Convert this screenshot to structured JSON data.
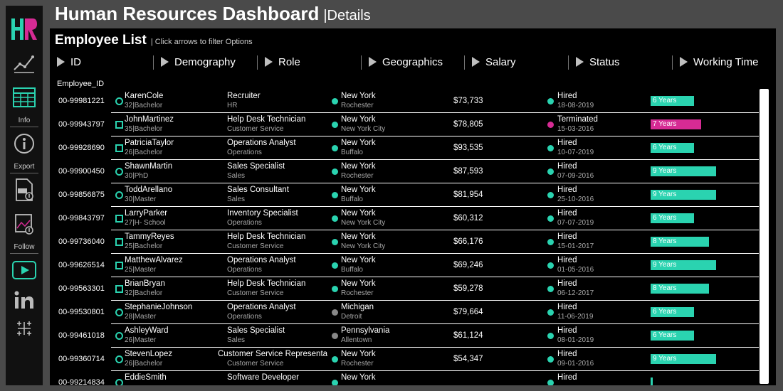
{
  "header": {
    "title": "Human Resources Dashboard",
    "subtitle": "|Details"
  },
  "sidebar": {
    "logo": "HR",
    "info_label": "Info",
    "export_label": "Export",
    "follow_label": "Follow",
    "colors": {
      "accent": "#2ad3b0",
      "accent2": "#d62b94"
    }
  },
  "panel": {
    "title": "Employee List",
    "hint": "| Click arrows to filter Options"
  },
  "columns": [
    "ID",
    "Demography",
    "Role",
    "Geographics",
    "Salary",
    "Status",
    "Working Time"
  ],
  "employee_id_header": "Employee_ID",
  "colors": {
    "teal": "#2ad3b0",
    "magenta": "#d62b94",
    "gray": "#888888"
  },
  "rows": [
    {
      "id": "00-99981221",
      "mark": "circle",
      "name": "KarenCole",
      "demo": "32|Bachelor",
      "role": "Recruiter",
      "dept": "HR",
      "geo_dot": "teal",
      "state": "New York",
      "city": "Rochester",
      "salary": "$73,733",
      "status": "Hired",
      "status_dot": "teal",
      "date": "18-08-2019",
      "years": "6 Years",
      "years_num": 6,
      "bar": "teal"
    },
    {
      "id": "00-99943797",
      "mark": "square",
      "name": "JohnMartinez",
      "demo": "35|Bachelor",
      "role": "Help Desk Technician",
      "dept": "Customer Service",
      "geo_dot": "teal",
      "state": "New York",
      "city": "New York City",
      "salary": "$78,805",
      "status": "Terminated",
      "status_dot": "magenta",
      "date": "15-03-2016",
      "years": "7 Years",
      "years_num": 7,
      "bar": "magenta"
    },
    {
      "id": "00-99928690",
      "mark": "square",
      "name": "PatriciaTaylor",
      "demo": "26|Bachelor",
      "role": "Operations Analyst",
      "dept": "Operations",
      "geo_dot": "teal",
      "state": "New York",
      "city": "Buffalo",
      "salary": "$93,535",
      "status": "Hired",
      "status_dot": "teal",
      "date": "10-07-2019",
      "years": "6 Years",
      "years_num": 6,
      "bar": "teal"
    },
    {
      "id": "00-99900450",
      "mark": "circle",
      "name": "ShawnMartin",
      "demo": "30|PhD",
      "role": "Sales Specialist",
      "dept": "Sales",
      "geo_dot": "teal",
      "state": "New York",
      "city": "Rochester",
      "salary": "$87,593",
      "status": "Hired",
      "status_dot": "teal",
      "date": "07-09-2016",
      "years": "9 Years",
      "years_num": 9,
      "bar": "teal"
    },
    {
      "id": "00-99856875",
      "mark": "circle",
      "name": "ToddArellano",
      "demo": "30|Master",
      "role": "Sales Consultant",
      "dept": "Sales",
      "geo_dot": "teal",
      "state": "New York",
      "city": "Buffalo",
      "salary": "$81,954",
      "status": "Hired",
      "status_dot": "teal",
      "date": "25-10-2016",
      "years": "9 Years",
      "years_num": 9,
      "bar": "teal"
    },
    {
      "id": "00-99843797",
      "mark": "square",
      "name": "LarryParker",
      "demo": "27|H- School",
      "role": "Inventory Specialist",
      "dept": "Operations",
      "geo_dot": "teal",
      "state": "New York",
      "city": "New York City",
      "salary": "$60,312",
      "status": "Hired",
      "status_dot": "teal",
      "date": "07-07-2019",
      "years": "6 Years",
      "years_num": 6,
      "bar": "teal"
    },
    {
      "id": "00-99736040",
      "mark": "square",
      "name": "TammyReyes",
      "demo": "25|Bachelor",
      "role": "Help Desk Technician",
      "dept": "Customer Service",
      "geo_dot": "teal",
      "state": "New York",
      "city": "New York City",
      "salary": "$66,176",
      "status": "Hired",
      "status_dot": "teal",
      "date": "15-01-2017",
      "years": "8 Years",
      "years_num": 8,
      "bar": "teal"
    },
    {
      "id": "00-99626514",
      "mark": "square",
      "name": "MatthewAlvarez",
      "demo": "25|Master",
      "role": "Operations Analyst",
      "dept": "Operations",
      "geo_dot": "teal",
      "state": "New York",
      "city": "Buffalo",
      "salary": "$69,246",
      "status": "Hired",
      "status_dot": "teal",
      "date": "01-05-2016",
      "years": "9 Years",
      "years_num": 9,
      "bar": "teal"
    },
    {
      "id": "00-99563301",
      "mark": "square",
      "name": "BrianBryan",
      "demo": "32|Bachelor",
      "role": "Help Desk Technician",
      "dept": "Customer Service",
      "geo_dot": "teal",
      "state": "New York",
      "city": "Rochester",
      "salary": "$59,278",
      "status": "Hired",
      "status_dot": "teal",
      "date": "06-12-2017",
      "years": "8 Years",
      "years_num": 8,
      "bar": "teal"
    },
    {
      "id": "00-99530801",
      "mark": "circle",
      "name": "StephanieJohnson",
      "demo": "28|Master",
      "role": "Operations Analyst",
      "dept": "Operations",
      "geo_dot": "gray",
      "state": "Michigan",
      "city": "Detroit",
      "salary": "$79,664",
      "status": "Hired",
      "status_dot": "teal",
      "date": "11-06-2019",
      "years": "6 Years",
      "years_num": 6,
      "bar": "teal"
    },
    {
      "id": "00-99461018",
      "mark": "circle",
      "name": "AshleyWard",
      "demo": "26|Master",
      "role": "Sales Specialist",
      "dept": "Sales",
      "geo_dot": "gray",
      "state": "Pennsylvania",
      "city": "Allentown",
      "salary": "$61,124",
      "status": "Hired",
      "status_dot": "teal",
      "date": "08-01-2019",
      "years": "6 Years",
      "years_num": 6,
      "bar": "teal"
    },
    {
      "id": "00-99360714",
      "mark": "circle",
      "name": "StevenLopez",
      "demo": "26|Bachelor",
      "role": "Customer Service Representative",
      "dept": "Customer Service",
      "geo_dot": "teal",
      "state": "New York",
      "city": "Rochester",
      "salary": "$54,347",
      "status": "Hired",
      "status_dot": "teal",
      "date": "09-01-2016",
      "years": "9 Years",
      "years_num": 9,
      "bar": "teal"
    },
    {
      "id": "00-99214834",
      "mark": "circle",
      "name": "EddieSmith",
      "demo": "",
      "role": "Software Developer",
      "dept": "",
      "geo_dot": "teal",
      "state": "New York",
      "city": "",
      "salary": "",
      "status": "Hired",
      "status_dot": "teal",
      "date": "",
      "years": "",
      "years_num": 0,
      "bar": "teal"
    }
  ]
}
